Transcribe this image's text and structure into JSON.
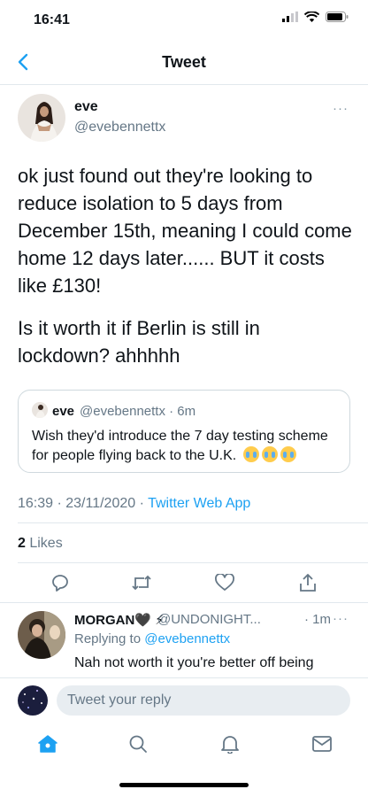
{
  "status_bar": {
    "time": "16:41"
  },
  "nav": {
    "title": "Tweet"
  },
  "tweet": {
    "name": "eve",
    "handle": "@evebennettx",
    "more": "···",
    "text_paragraph_1": "ok just found out they're looking to reduce isolation to 5 days from December 15th, meaning I could come home 12 days later...... BUT it costs like £130!",
    "text_paragraph_2": "Is it worth it if Berlin is still in lockdown? ahhhhh",
    "quoted": {
      "name": "eve",
      "handle": "@evebennettx · 6m",
      "text": "Wish they'd introduce the 7 day testing scheme for people flying back to the U.K."
    },
    "timestamp": "16:39 · 23/11/2020 · ",
    "source": "Twitter Web App",
    "likes_count": "2",
    "likes_label": " Likes"
  },
  "reply": {
    "name": "MORGAN🖤 ⚡",
    "handle": "@UNDONIGHT...",
    "time": "· 1m",
    "more": "···",
    "replying_prefix": "Replying to ",
    "replying_to": "@evebennettx",
    "text": "Nah not worth it you're better off being"
  },
  "compose": {
    "placeholder": "Tweet your reply"
  },
  "colors": {
    "accent": "#1da1f2",
    "secondary_text": "#657786",
    "divider": "#e1e8ed"
  }
}
